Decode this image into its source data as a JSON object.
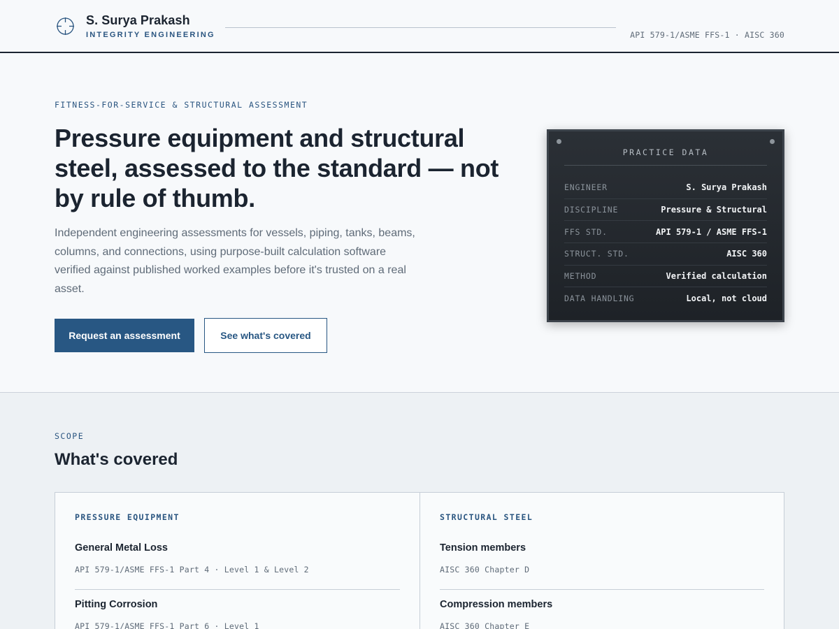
{
  "header": {
    "name": "S. Surya Prakash",
    "subtitle": "INTEGRITY ENGINEERING",
    "standards": "API 579-1/ASME FFS-1 · AISC 360",
    "icon": "crosshair-icon"
  },
  "hero": {
    "eyebrow": "FITNESS-FOR-SERVICE & STRUCTURAL ASSESSMENT",
    "title": "Pressure equipment and structural steel, assessed to the standard — not by rule of thumb.",
    "description": "Independent engineering assessments for vessels, piping, tanks, beams, columns, and connections, using purpose-built calculation software verified against published worked examples before it's trusted on a real asset.",
    "primary_button": "Request an assessment",
    "secondary_button": "See what's covered"
  },
  "panel": {
    "title": "PRACTICE DATA",
    "rows": [
      {
        "key": "ENGINEER",
        "value": "S. Surya Prakash"
      },
      {
        "key": "DISCIPLINE",
        "value": "Pressure & Structural"
      },
      {
        "key": "FFS STD.",
        "value": "API 579-1 / ASME FFS-1"
      },
      {
        "key": "STRUCT. STD.",
        "value": "AISC 360"
      },
      {
        "key": "METHOD",
        "value": "Verified calculation"
      },
      {
        "key": "DATA HANDLING",
        "value": "Local, not cloud"
      }
    ]
  },
  "scope": {
    "eyebrow": "SCOPE",
    "title": "What's covered",
    "cards": [
      {
        "heading": "PRESSURE EQUIPMENT",
        "items": [
          {
            "title": "General Metal Loss",
            "ref": "API 579-1/ASME FFS-1 Part 4 · Level 1 & Level 2"
          },
          {
            "title": "Pitting Corrosion",
            "ref": "API 579-1/ASME FFS-1 Part 6 · Level 1"
          }
        ]
      },
      {
        "heading": "STRUCTURAL STEEL",
        "items": [
          {
            "title": "Tension members",
            "ref": "AISC 360 Chapter D"
          },
          {
            "title": "Compression members",
            "ref": "AISC 360 Chapter E"
          }
        ]
      }
    ]
  },
  "colors": {
    "accent": "#285783",
    "ink": "#1b2430",
    "panel_bg": "#23282e"
  }
}
